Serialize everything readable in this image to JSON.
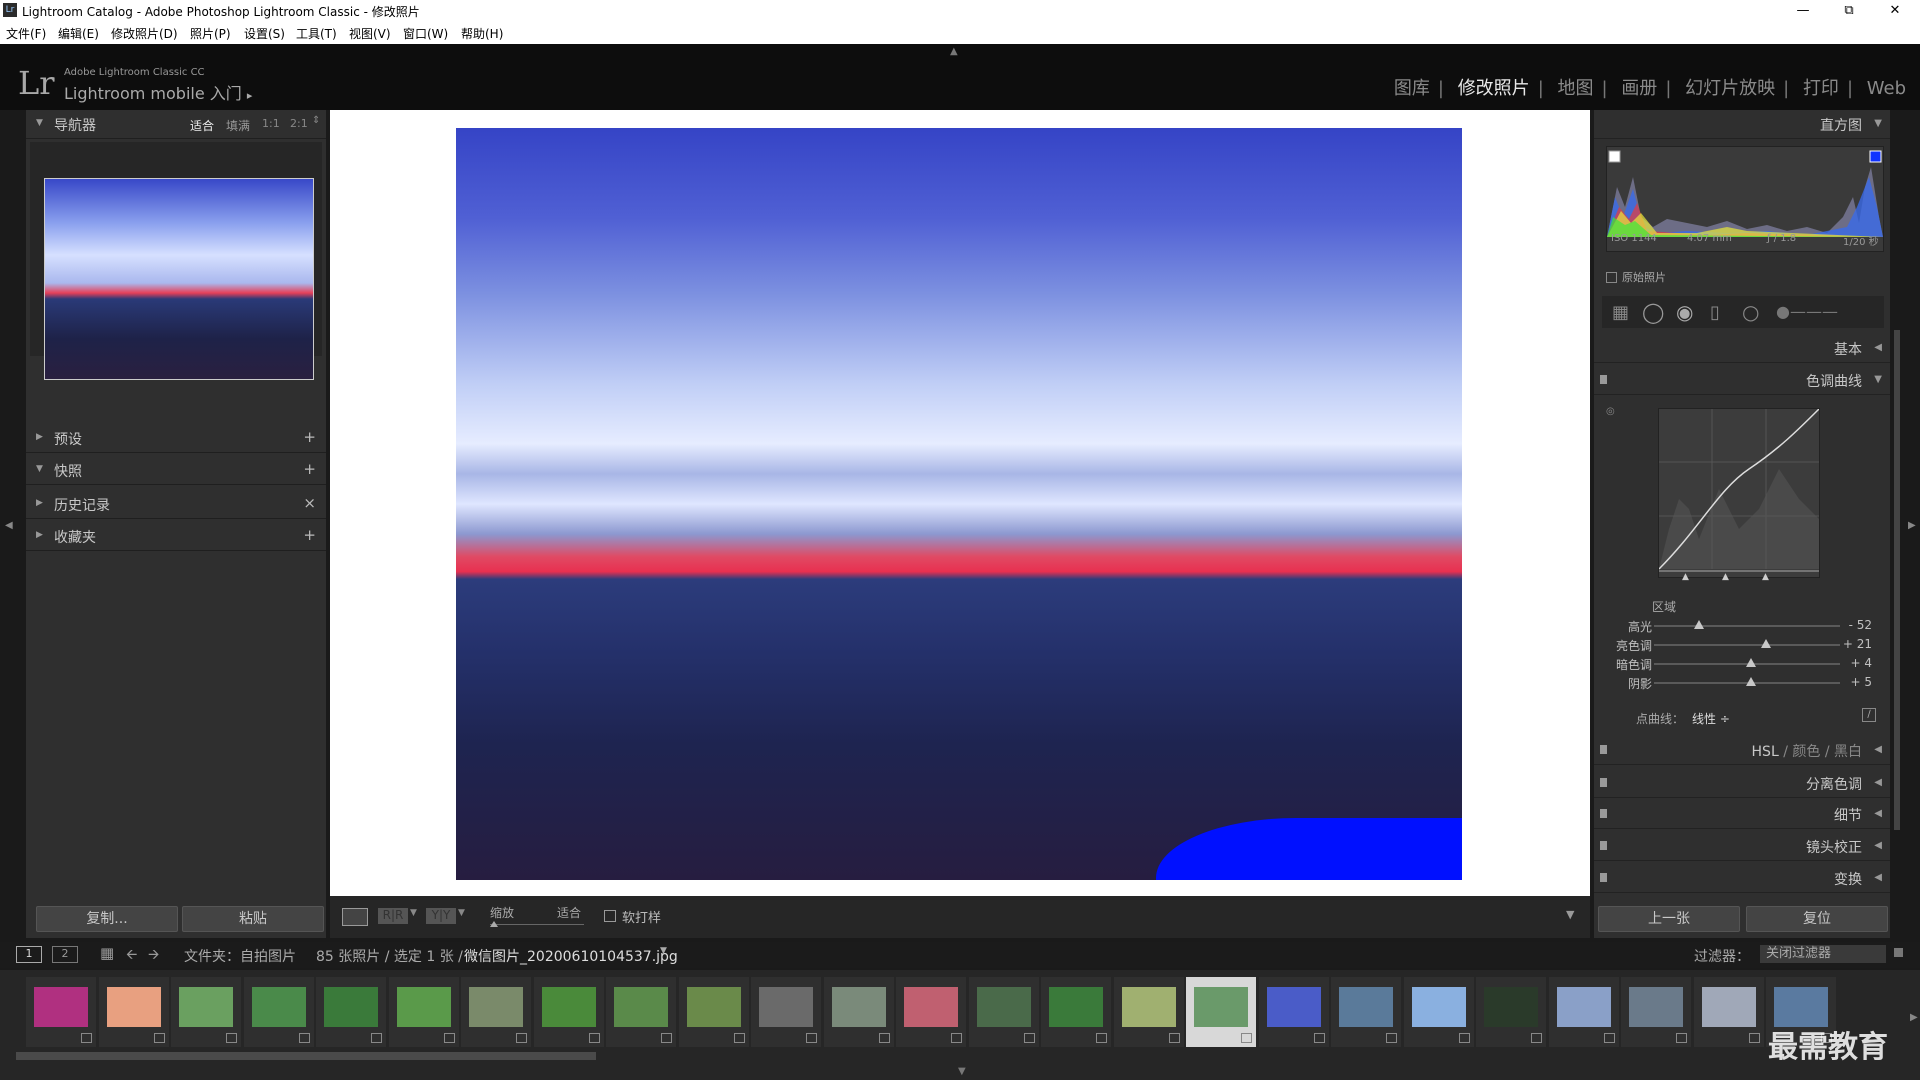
{
  "window": {
    "title": "Lightroom Catalog - Adobe Photoshop Lightroom Classic - 修改照片",
    "app_icon": "Lr",
    "controls": [
      "minimize-icon",
      "restore-icon",
      "close-icon"
    ]
  },
  "menu": [
    "文件(F)",
    "编辑(E)",
    "修改照片(D)",
    "照片(P)",
    "设置(S)",
    "工具(T)",
    "视图(V)",
    "窗口(W)",
    "帮助(H)"
  ],
  "identity": {
    "logo": "Lr",
    "product": "Adobe Lightroom Classic CC",
    "mobile": "Lightroom mobile 入门",
    "mobile_arrow": "▸",
    "modules": [
      "图库",
      "修改照片",
      "地图",
      "画册",
      "幻灯片放映",
      "打印",
      "Web"
    ],
    "active_module": "修改照片"
  },
  "left": {
    "navigator": {
      "title": "导航器",
      "zoom": [
        "适合",
        "填满",
        "1:1",
        "2:1"
      ]
    },
    "panels": [
      {
        "title": "预设",
        "action": "+"
      },
      {
        "title": "快照",
        "action": "+"
      },
      {
        "title": "历史记录",
        "action": "×"
      },
      {
        "title": "收藏夹",
        "action": "+"
      }
    ],
    "copy_button": "复制...",
    "paste_button": "粘贴"
  },
  "toolbar": {
    "zoom_label": "缩放",
    "zoom_value": "适合",
    "softproof_label": "软打样",
    "view_icons": [
      "loupe-view-icon",
      "before-after-icon",
      "yy-compare-icon"
    ],
    "view_labels": [
      "R|R",
      "Y|Y"
    ]
  },
  "right": {
    "histogram": {
      "title": "直方图",
      "iso": "ISO 1144",
      "focal": "4.07 mm",
      "aperture": "ƒ / 1.8",
      "shutter": "1/20 秒",
      "original_label": "原始照片"
    },
    "basic_title": "基本",
    "tone_curve": {
      "title": "色调曲线",
      "region_label": "区域",
      "sliders": [
        {
          "name": "高光",
          "value": "- 52",
          "level": 0.24
        },
        {
          "name": "亮色调",
          "value": "+ 21",
          "level": 0.6
        },
        {
          "name": "暗色调",
          "value": "+ 4",
          "level": 0.52
        },
        {
          "name": "阴影",
          "value": "+ 5",
          "level": 0.52
        }
      ],
      "point_curve_label": "点曲线：",
      "point_curve_value": "线性 ÷"
    },
    "hsl": {
      "hsl": "HSL",
      "color": "颜色",
      "bw": "黑白"
    },
    "sections": [
      "分离色调",
      "细节",
      "镜头校正",
      "变换"
    ],
    "prev_button": "上一张",
    "reset_button": "复位"
  },
  "filmstrip": {
    "page1": "1",
    "page2": "2",
    "source_text": "文件夹：自拍图片",
    "count_text": "85 张照片 / 选定 1 张 /",
    "filename": "微信图片_20200610104537.jpg",
    "filter_label": "过滤器：",
    "filter_value": "关闭过滤器",
    "thumbs_count": 25,
    "selected_index": 16,
    "watermark": "最需教育"
  },
  "colors": {
    "accent_selected": "#d8d8d8",
    "sky_top": "#3a48c8",
    "sky_mid": "#c8d6ff",
    "horizon_red": "#e8304a",
    "clip_blue": "#0010ff"
  }
}
